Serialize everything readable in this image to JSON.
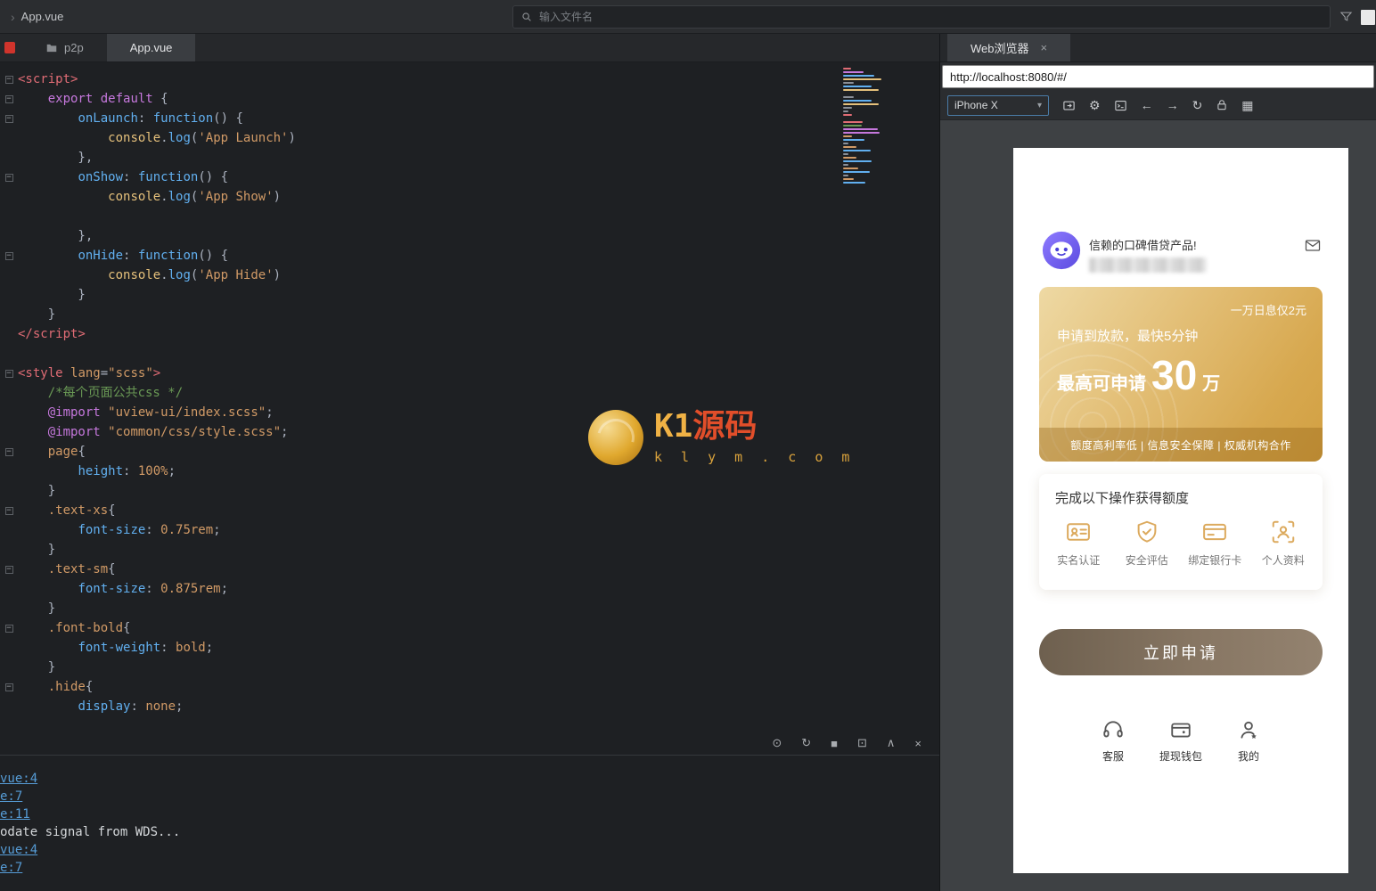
{
  "top_bar": {
    "chevron": "›",
    "breadcrumb": "App.vue",
    "search_placeholder": "输入文件名"
  },
  "editor": {
    "tabs": [
      {
        "label": "p2p"
      },
      {
        "label": "App.vue"
      }
    ],
    "fold_glyph": "−",
    "code_lines": [
      {
        "fold": true,
        "tokens": [
          [
            "<script>",
            "tag"
          ]
        ]
      },
      {
        "fold": true,
        "tokens": [
          [
            "    ",
            "p"
          ],
          [
            "export",
            "kw"
          ],
          [
            " ",
            "p"
          ],
          [
            "default",
            "kw"
          ],
          [
            " {",
            "p"
          ]
        ]
      },
      {
        "fold": true,
        "tokens": [
          [
            "        ",
            "p"
          ],
          [
            "onLaunch",
            "prop"
          ],
          [
            ": ",
            "p"
          ],
          [
            "function",
            "fn"
          ],
          [
            "() {",
            "p"
          ]
        ]
      },
      {
        "tokens": [
          [
            "            ",
            "p"
          ],
          [
            "console",
            "obj"
          ],
          [
            ".",
            "p"
          ],
          [
            "log",
            "fn"
          ],
          [
            "(",
            "p"
          ],
          [
            "'App Launch'",
            "str"
          ],
          [
            ")",
            "p"
          ]
        ]
      },
      {
        "tokens": [
          [
            "        },",
            "p"
          ]
        ]
      },
      {
        "fold": true,
        "tokens": [
          [
            "        ",
            "p"
          ],
          [
            "onShow",
            "prop"
          ],
          [
            ": ",
            "p"
          ],
          [
            "function",
            "fn"
          ],
          [
            "() {",
            "p"
          ]
        ]
      },
      {
        "tokens": [
          [
            "            ",
            "p"
          ],
          [
            "console",
            "obj"
          ],
          [
            ".",
            "p"
          ],
          [
            "log",
            "fn"
          ],
          [
            "(",
            "p"
          ],
          [
            "'App Show'",
            "str"
          ],
          [
            ")",
            "p"
          ]
        ]
      },
      {
        "tokens": []
      },
      {
        "tokens": [
          [
            "        },",
            "p"
          ]
        ]
      },
      {
        "fold": true,
        "tokens": [
          [
            "        ",
            "p"
          ],
          [
            "onHide",
            "prop"
          ],
          [
            ": ",
            "p"
          ],
          [
            "function",
            "fn"
          ],
          [
            "() {",
            "p"
          ]
        ]
      },
      {
        "tokens": [
          [
            "            ",
            "p"
          ],
          [
            "console",
            "obj"
          ],
          [
            ".",
            "p"
          ],
          [
            "log",
            "fn"
          ],
          [
            "(",
            "p"
          ],
          [
            "'App Hide'",
            "str"
          ],
          [
            ")",
            "p"
          ]
        ]
      },
      {
        "tokens": [
          [
            "        }",
            "p"
          ]
        ]
      },
      {
        "tokens": [
          [
            "    }",
            "p"
          ]
        ]
      },
      {
        "tokens": [
          [
            "</script>",
            "tag"
          ]
        ]
      },
      {
        "tokens": []
      },
      {
        "fold": true,
        "tokens": [
          [
            "<style ",
            "tag"
          ],
          [
            "lang",
            "attr"
          ],
          [
            "=",
            "p"
          ],
          [
            "\"scss\"",
            "str"
          ],
          [
            ">",
            "tag"
          ]
        ]
      },
      {
        "tokens": [
          [
            "    ",
            "p"
          ],
          [
            "/*每个页面公共css */",
            "cm"
          ]
        ]
      },
      {
        "tokens": [
          [
            "    ",
            "p"
          ],
          [
            "@import",
            "kw"
          ],
          [
            " ",
            "p"
          ],
          [
            "\"uview-ui/index.scss\"",
            "str"
          ],
          [
            ";",
            "p"
          ]
        ]
      },
      {
        "tokens": [
          [
            "    ",
            "p"
          ],
          [
            "@import",
            "kw"
          ],
          [
            " ",
            "p"
          ],
          [
            "\"common/css/style.scss\"",
            "str"
          ],
          [
            ";",
            "p"
          ]
        ]
      },
      {
        "fold": true,
        "tokens": [
          [
            "    ",
            "p"
          ],
          [
            "page",
            "sel"
          ],
          [
            "{",
            "p"
          ]
        ]
      },
      {
        "tokens": [
          [
            "        ",
            "p"
          ],
          [
            "height",
            "prop"
          ],
          [
            ": ",
            "p"
          ],
          [
            "100%",
            "val"
          ],
          [
            ";",
            "p"
          ]
        ]
      },
      {
        "tokens": [
          [
            "    }",
            "p"
          ]
        ]
      },
      {
        "fold": true,
        "tokens": [
          [
            "    ",
            "p"
          ],
          [
            ".text-xs",
            "sel"
          ],
          [
            "{",
            "p"
          ]
        ]
      },
      {
        "tokens": [
          [
            "        ",
            "p"
          ],
          [
            "font-size",
            "prop"
          ],
          [
            ": ",
            "p"
          ],
          [
            "0.75rem",
            "val"
          ],
          [
            ";",
            "p"
          ]
        ]
      },
      {
        "tokens": [
          [
            "    }",
            "p"
          ]
        ]
      },
      {
        "fold": true,
        "tokens": [
          [
            "    ",
            "p"
          ],
          [
            ".text-sm",
            "sel"
          ],
          [
            "{",
            "p"
          ]
        ]
      },
      {
        "tokens": [
          [
            "        ",
            "p"
          ],
          [
            "font-size",
            "prop"
          ],
          [
            ": ",
            "p"
          ],
          [
            "0.875rem",
            "val"
          ],
          [
            ";",
            "p"
          ]
        ]
      },
      {
        "tokens": [
          [
            "    }",
            "p"
          ]
        ]
      },
      {
        "fold": true,
        "tokens": [
          [
            "    ",
            "p"
          ],
          [
            ".font-bold",
            "sel"
          ],
          [
            "{",
            "p"
          ]
        ]
      },
      {
        "tokens": [
          [
            "        ",
            "p"
          ],
          [
            "font-weight",
            "prop"
          ],
          [
            ": ",
            "p"
          ],
          [
            "bold",
            "val"
          ],
          [
            ";",
            "p"
          ]
        ]
      },
      {
        "tokens": [
          [
            "    }",
            "p"
          ]
        ]
      },
      {
        "fold": true,
        "tokens": [
          [
            "    ",
            "p"
          ],
          [
            ".hide",
            "sel"
          ],
          [
            "{",
            "p"
          ]
        ]
      },
      {
        "tokens": [
          [
            "        ",
            "p"
          ],
          [
            "display",
            "prop"
          ],
          [
            ": ",
            "p"
          ],
          [
            "none",
            "val"
          ],
          [
            ";",
            "p"
          ]
        ]
      }
    ],
    "console_toolbar": [
      {
        "name": "debug",
        "glyph": "⊙"
      },
      {
        "name": "restart",
        "glyph": "↻"
      },
      {
        "name": "stop",
        "glyph": "■"
      },
      {
        "name": "export",
        "glyph": "⊡"
      },
      {
        "name": "collapse",
        "glyph": "∧"
      },
      {
        "name": "close",
        "glyph": "×"
      }
    ],
    "console_lines": [
      {
        "text": "vue:4",
        "link": true
      },
      {
        "text": "e:7",
        "link": true
      },
      {
        "text": "e:11",
        "link": true
      },
      {
        "text": "odate signal from WDS...",
        "link": false
      },
      {
        "text": "vue:4",
        "link": true
      },
      {
        "text": "e:7",
        "link": true
      }
    ]
  },
  "watermark": {
    "brand_prefix": "K1",
    "brand_suffix": "源码",
    "domain": "k l y m . c o m"
  },
  "browser": {
    "tab_label": "Web浏览器",
    "tab_close_glyph": "×",
    "url": "http://localhost:8080/#/",
    "device": "iPhone X",
    "glyphs": {
      "caret": "▾",
      "back": "←",
      "forward": "→",
      "refresh": "↻",
      "gear": "⚙",
      "qr": "▦"
    },
    "page": {
      "header_title": "信赖的口碑借贷产品!",
      "banner": {
        "corner": "一万日息仅2元",
        "line1": "申请到放款，最快5分钟",
        "amount_prefix": "最高可申请",
        "amount": "30",
        "amount_unit": "万",
        "footer": "额度高利率低 | 信息安全保障 | 权威机构合作"
      },
      "section_title": "完成以下操作获得额度",
      "operations": [
        {
          "label": "实名认证"
        },
        {
          "label": "安全评估"
        },
        {
          "label": "绑定银行卡"
        },
        {
          "label": "个人资料"
        }
      ],
      "apply_button": "立即申请",
      "bottom_nav": [
        {
          "label": "客服"
        },
        {
          "label": "提现钱包"
        },
        {
          "label": "我的"
        }
      ]
    },
    "colors": {
      "banner_gold": "#d7a84f",
      "accent_gold": "#dcaa5e",
      "apply_brown": "#6e604f"
    }
  }
}
